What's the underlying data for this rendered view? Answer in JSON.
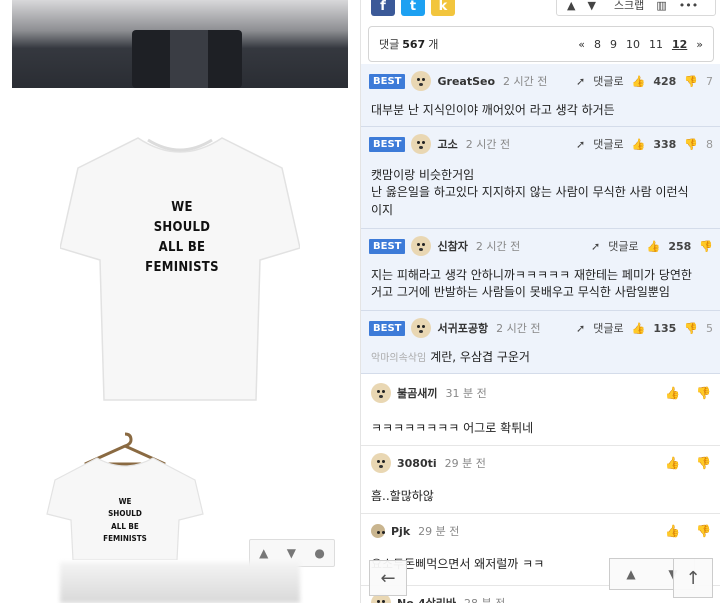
{
  "left": {
    "shirt1_lines": [
      "WE",
      "SHOULD",
      "ALL BE",
      "FEMINISTS"
    ],
    "shirt2_lines": [
      "WE",
      "SHOULD",
      "ALL BE",
      "FEMINISTS"
    ],
    "vote_up": "▲",
    "vote_down": "▼",
    "vote_comment": "●"
  },
  "share": {
    "facebook": "f",
    "twitter": "t",
    "kakao": "k",
    "tools_scrap": "스크랩",
    "tools_more": "•••"
  },
  "pager": {
    "count_label": "댓글",
    "count": "567",
    "count_unit": "개",
    "first": "«",
    "pages": [
      "8",
      "9",
      "10",
      "11",
      "12"
    ],
    "current": "12",
    "next": "»"
  },
  "best_comments": [
    {
      "badge": "BEST",
      "user": "GreatSeo",
      "time": "2 시간 전",
      "reply": "댓글로",
      "up": "428",
      "down": "7",
      "text": [
        "대부분 난 지식인이야 깨어있어 라고 생각 하거든"
      ]
    },
    {
      "badge": "BEST",
      "user": "고소",
      "time": "2 시간 전",
      "reply": "댓글로",
      "up": "338",
      "down": "8",
      "text": [
        "캣맘이랑 비슷한거임",
        "난 옳은일을 하고있다 지지하지 않는 사람이 무식한 사람 이런식",
        "이지"
      ]
    },
    {
      "badge": "BEST",
      "user": "신참자",
      "time": "2 시간 전",
      "reply": "댓글로",
      "up": "258",
      "down": "",
      "text": [
        "지는 피해라고 생각 안하니까ㅋㅋㅋㅋㅋ 재한테는 페미가 당연한",
        "거고 그거에 반발하는 사람들이 못배우고 무식한 사람일뿐임"
      ]
    },
    {
      "badge": "BEST",
      "user": "서귀포공항",
      "time": "2 시간 전",
      "reply": "댓글로",
      "up": "135",
      "down": "5",
      "prefix": "악마의속삭임",
      "text": [
        "계란, 우삼겹 구운거"
      ]
    }
  ],
  "comments": [
    {
      "user": "불곰새끼",
      "time": "31 분 전",
      "text": "ㅋㅋㅋㅋㅋㅋㅋㅋ 어그로 확튀네"
    },
    {
      "user": "3080ti",
      "time": "29 분 전",
      "text": "흠..할많하않"
    },
    {
      "user": "Pjk",
      "time": "29 분 전",
      "text": "요소두돈삐먹으면서 왜저럴까 ㅋㅋ"
    },
    {
      "user": "No.4살리바",
      "time": "28 분 전",
      "text": ""
    }
  ],
  "float": {
    "back": "←",
    "up": "▲",
    "down": "▼",
    "top": "↑"
  }
}
